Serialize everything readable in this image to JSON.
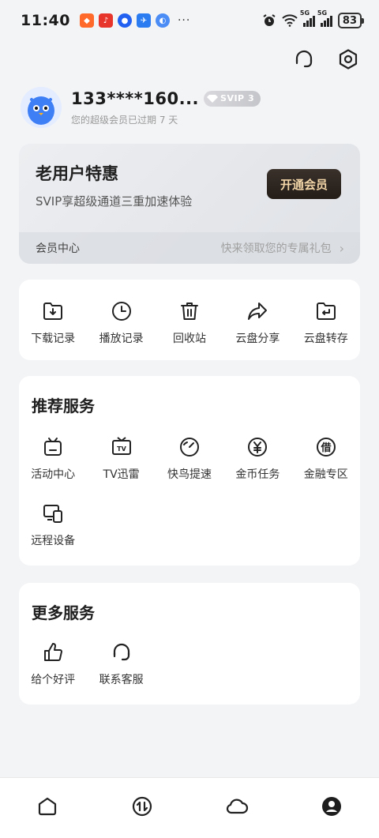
{
  "status_bar": {
    "time": "11:40",
    "more": "···",
    "network_1": "5G",
    "network_2": "5G",
    "battery": "83"
  },
  "header": {
    "icons": [
      "headset-icon",
      "settings-icon"
    ]
  },
  "profile": {
    "username": "133****160...",
    "badge": "SVIP 3",
    "subtitle": "您的超级会员已过期 7 天"
  },
  "vip_card": {
    "title": "老用户特惠",
    "description": "SVIP享超级通道三重加速体验",
    "button": "开通会员",
    "footer_left": "会员中心",
    "footer_right": "快来领取您的专属礼包"
  },
  "tools": [
    {
      "label": "下载记录",
      "icon": "download-folder-icon"
    },
    {
      "label": "播放记录",
      "icon": "clock-icon"
    },
    {
      "label": "回收站",
      "icon": "trash-icon"
    },
    {
      "label": "云盘分享",
      "icon": "share-icon"
    },
    {
      "label": "云盘转存",
      "icon": "transfer-folder-icon"
    }
  ],
  "recommended": {
    "title": "推荐服务",
    "items": [
      {
        "label": "活动中心",
        "icon": "activity-tv-icon"
      },
      {
        "label": "TV迅雷",
        "icon": "tv-icon"
      },
      {
        "label": "快鸟提速",
        "icon": "speedometer-icon"
      },
      {
        "label": "金币任务",
        "icon": "coin-icon"
      },
      {
        "label": "金融专区",
        "icon": "loan-icon"
      },
      {
        "label": "远程设备",
        "icon": "remote-device-icon"
      }
    ]
  },
  "more_services": {
    "title": "更多服务",
    "items": [
      {
        "label": "给个好评",
        "icon": "thumbs-up-icon"
      },
      {
        "label": "联系客服",
        "icon": "customer-service-icon"
      }
    ]
  },
  "bottom_nav": [
    {
      "name": "home",
      "icon": "home-icon"
    },
    {
      "name": "transfer",
      "icon": "transfer-icon"
    },
    {
      "name": "cloud",
      "icon": "cloud-icon"
    },
    {
      "name": "me",
      "icon": "profile-icon",
      "active": true
    }
  ],
  "colors": {
    "background": "#f3f4f6",
    "vip_button_bg": "#2b231d",
    "vip_button_text": "#f3d6a8",
    "svip_badge": "#c7c8cd",
    "avatar_blue": "#3f7ff6"
  }
}
